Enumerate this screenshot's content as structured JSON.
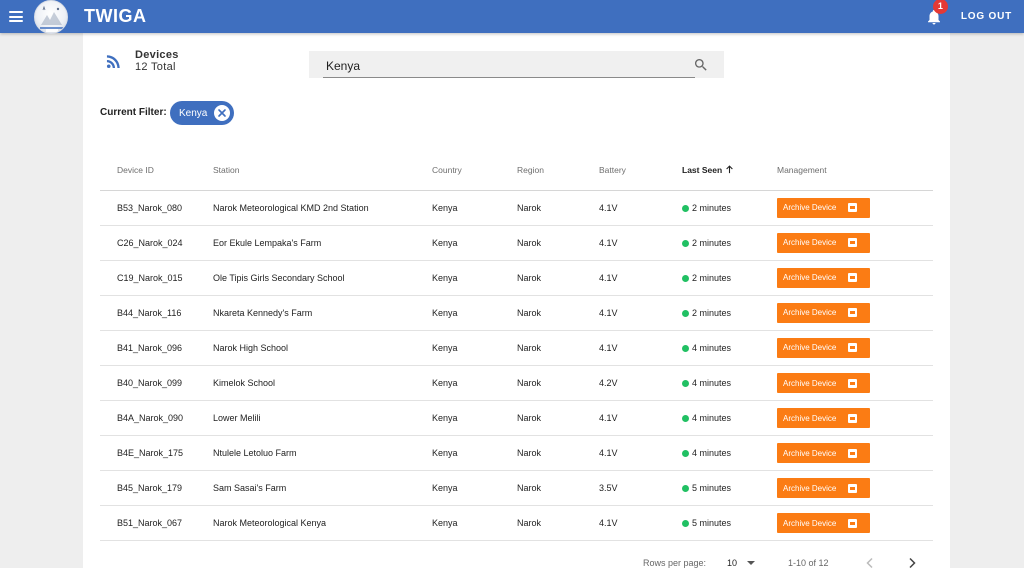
{
  "app": {
    "brand": "TWIGA",
    "logout_label": "LOG OUT",
    "notification_count": "1"
  },
  "colors": {
    "primary": "#3f6fbf",
    "accent": "#fb7c14",
    "online": "#21c063",
    "badge": "#e53935"
  },
  "header": {
    "title": "Devices",
    "total": "12 Total"
  },
  "search": {
    "value": "Kenya",
    "placeholder": ""
  },
  "filter": {
    "label": "Current Filter:",
    "chip": "Kenya"
  },
  "table": {
    "columns": [
      "Device ID",
      "Station",
      "Country",
      "Region",
      "Battery",
      "Last Seen",
      "Management"
    ],
    "sorted_column": "Last Seen",
    "sort_direction": "ascending",
    "action_label": "Archive Device",
    "rows": [
      {
        "device_id": "B53_Narok_080",
        "station": "Narok Meteorological KMD 2nd Station",
        "country": "Kenya",
        "region": "Narok",
        "battery": "4.1V",
        "last_seen": "2 minutes"
      },
      {
        "device_id": "C26_Narok_024",
        "station": "Eor Ekule Lempaka's Farm",
        "country": "Kenya",
        "region": "Narok",
        "battery": "4.1V",
        "last_seen": "2 minutes"
      },
      {
        "device_id": "C19_Narok_015",
        "station": "Ole Tipis Girls Secondary School",
        "country": "Kenya",
        "region": "Narok",
        "battery": "4.1V",
        "last_seen": "2 minutes"
      },
      {
        "device_id": "B44_Narok_116",
        "station": "Nkareta Kennedy's Farm",
        "country": "Kenya",
        "region": "Narok",
        "battery": "4.1V",
        "last_seen": "2 minutes"
      },
      {
        "device_id": "B41_Narok_096",
        "station": "Narok High School",
        "country": "Kenya",
        "region": "Narok",
        "battery": "4.1V",
        "last_seen": "4 minutes"
      },
      {
        "device_id": "B40_Narok_099",
        "station": "Kimelok School",
        "country": "Kenya",
        "region": "Narok",
        "battery": "4.2V",
        "last_seen": "4 minutes"
      },
      {
        "device_id": "B4A_Narok_090",
        "station": "Lower Melili",
        "country": "Kenya",
        "region": "Narok",
        "battery": "4.1V",
        "last_seen": "4 minutes"
      },
      {
        "device_id": "B4E_Narok_175",
        "station": "Ntulele Letoluo Farm",
        "country": "Kenya",
        "region": "Narok",
        "battery": "4.1V",
        "last_seen": "4 minutes"
      },
      {
        "device_id": "B45_Narok_179",
        "station": "Sam Sasai's Farm",
        "country": "Kenya",
        "region": "Narok",
        "battery": "3.5V",
        "last_seen": "5 minutes"
      },
      {
        "device_id": "B51_Narok_067",
        "station": "Narok Meteorological Kenya",
        "country": "Kenya",
        "region": "Narok",
        "battery": "4.1V",
        "last_seen": "5 minutes"
      }
    ]
  },
  "pagination": {
    "rows_per_page_label": "Rows per page:",
    "rows_per_page": "10",
    "range": "1-10 of 12"
  },
  "icons": [
    "menu-icon",
    "logo-image",
    "bell-icon",
    "rss-icon",
    "search-icon",
    "close-icon",
    "arrow-up-icon",
    "archive-icon",
    "chevron-left-icon",
    "chevron-right-icon",
    "caret-down-icon"
  ]
}
